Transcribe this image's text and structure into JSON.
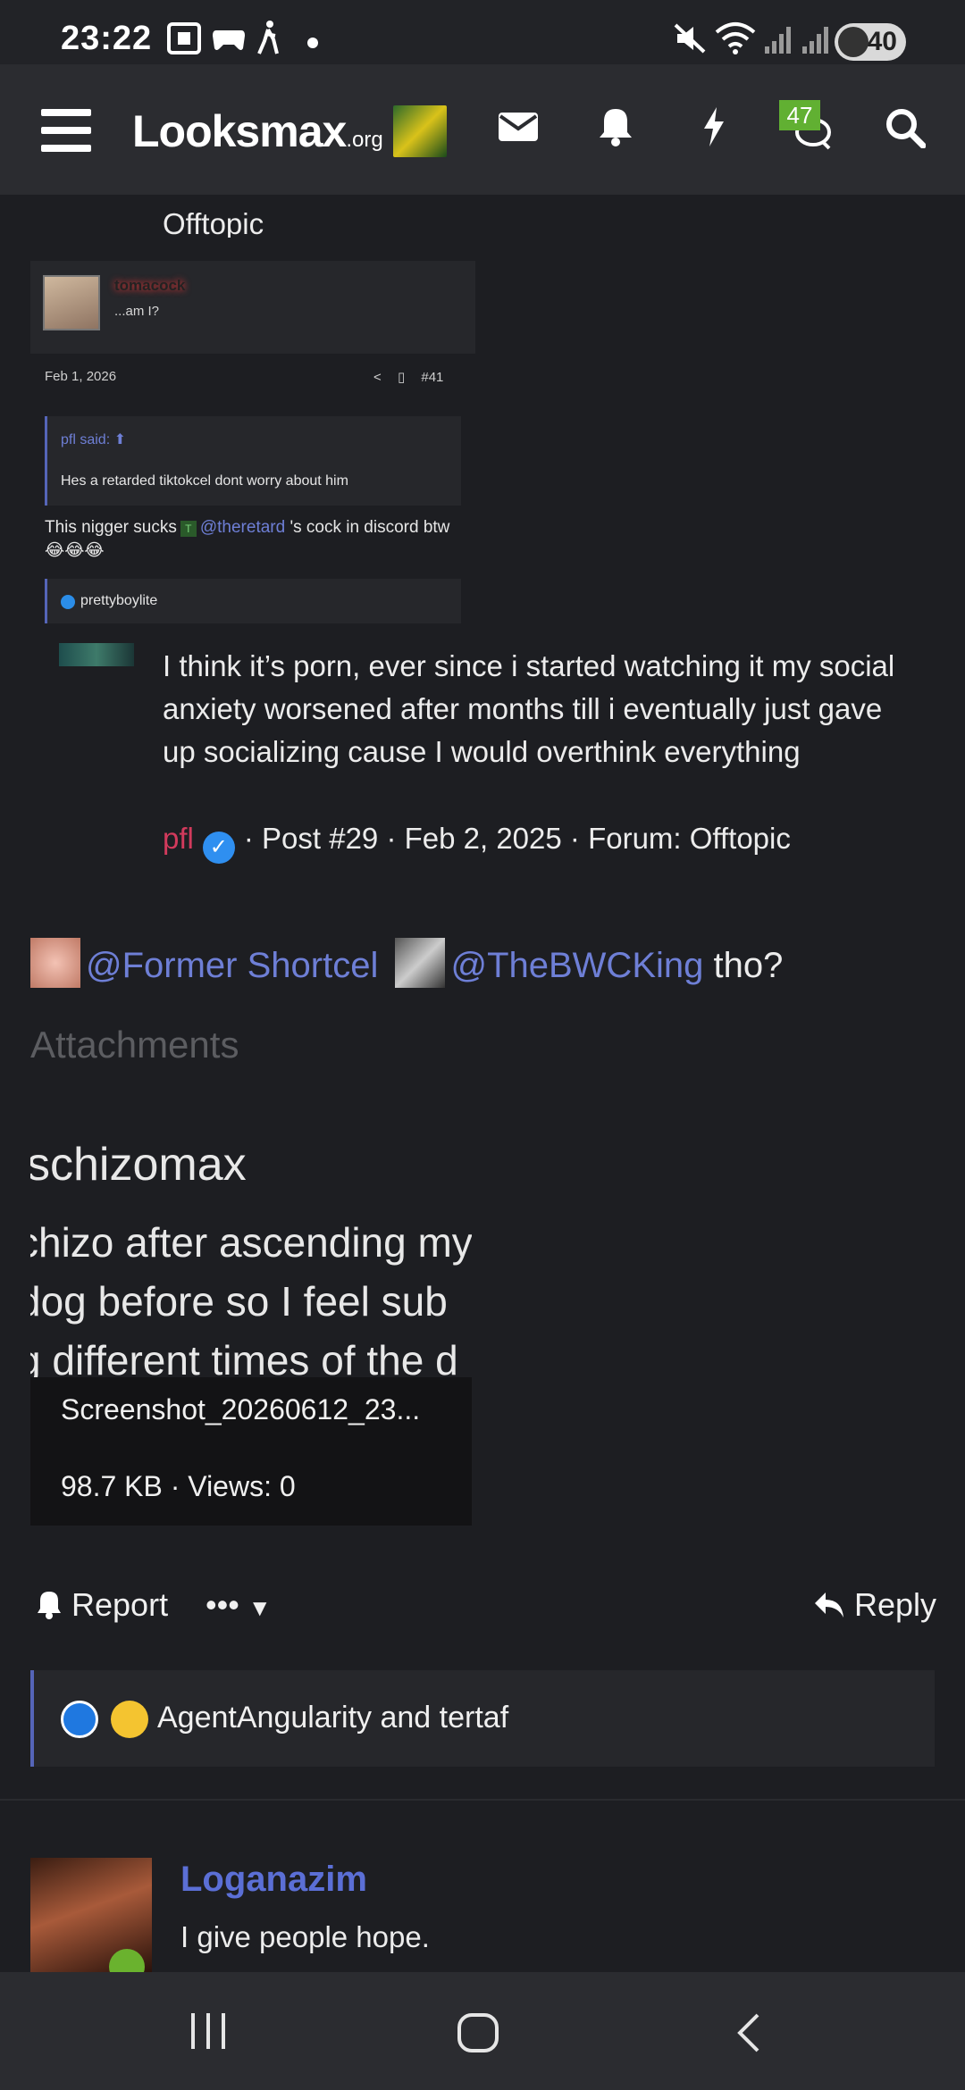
{
  "status_bar": {
    "time": "23:22",
    "battery": "40"
  },
  "header": {
    "logo_main": "Looksmax",
    "logo_suffix": ".org",
    "alerts_badge": "47"
  },
  "partial_top": {
    "forum_text": "Offtopic"
  },
  "embedded_quote": {
    "username": "tomacock",
    "user_title": "...am I?",
    "date": "Feb 1, 2026",
    "post_number": "#41",
    "quote_author": "pfl said:",
    "quote_text": "Hes a retarded tiktokcel dont worry about him",
    "body_before": "This nigger sucks",
    "tag_letter": "T",
    "mention": "@theretard",
    "body_after": "'s cock in discord btw 😂😂😂",
    "reaction_user": "prettyboylite"
  },
  "quoted_post": {
    "text": "I think it’s porn, ever since i started watching it my social anxiety worsened after months till i eventually just gave up socializing cause I would overthink everything",
    "author": "pfl",
    "meta": "· Post #29 · Feb 2, 2025 · Forum: Offtopic"
  },
  "mention_line": {
    "mention1": "@Former Shortcel",
    "mention2": "@TheBWCKing",
    "suffix": "tho?"
  },
  "attachments": {
    "heading": "Attachments",
    "preview_lines": [
      "schizomax",
      "chizo after ascending my",
      "dog before so I feel sub",
      "g different times of the d"
    ],
    "file_name": "Screenshot_20260612_23...",
    "file_info": "98.7 KB · Views: 0"
  },
  "actions": {
    "report": "Report",
    "more": "•••",
    "reply": "Reply"
  },
  "reactions": {
    "text": "AgentAngularity and tertaf"
  },
  "next_post": {
    "username": "Loganazim",
    "user_title": "I give people hope."
  }
}
